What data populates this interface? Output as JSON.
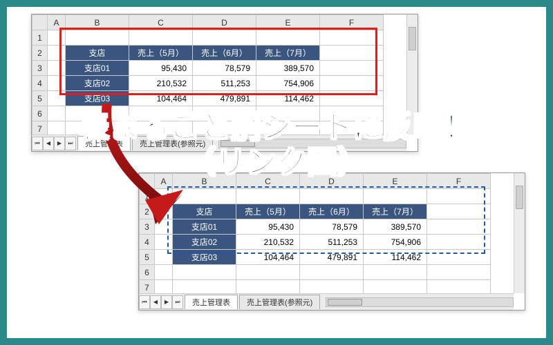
{
  "columns": [
    "",
    "A",
    "B",
    "C",
    "D",
    "E",
    "F"
  ],
  "rows": [
    "1",
    "2",
    "3",
    "4",
    "5",
    "6",
    "7"
  ],
  "table": {
    "headers": [
      "支店",
      "売上（5月）",
      "売上（6月）",
      "売上（7月）"
    ],
    "data": [
      {
        "store": "支店01",
        "m5": "95,430",
        "m6": "78,579",
        "m7": "389,570"
      },
      {
        "store": "支店02",
        "m5": "210,532",
        "m6": "511,253",
        "m7": "754,906"
      },
      {
        "store": "支店03",
        "m5": "104,464",
        "m6": "479,891",
        "m7": "114,462"
      }
    ]
  },
  "tabs": {
    "sheet1": [
      {
        "name": "売上管理表",
        "active": true
      },
      {
        "name": "売上管理表(参照元)",
        "active": false
      }
    ],
    "sheet2": [
      {
        "name": "売上管理表",
        "active": true
      },
      {
        "name": "売上管理表(参照元)",
        "active": false
      }
    ]
  },
  "headline": {
    "line1": "表まるごと別シートに反映！",
    "line2": "（リンク図）"
  },
  "nav": {
    "first": "⏮",
    "prev": "◀",
    "next": "▶",
    "last": "⏭"
  }
}
